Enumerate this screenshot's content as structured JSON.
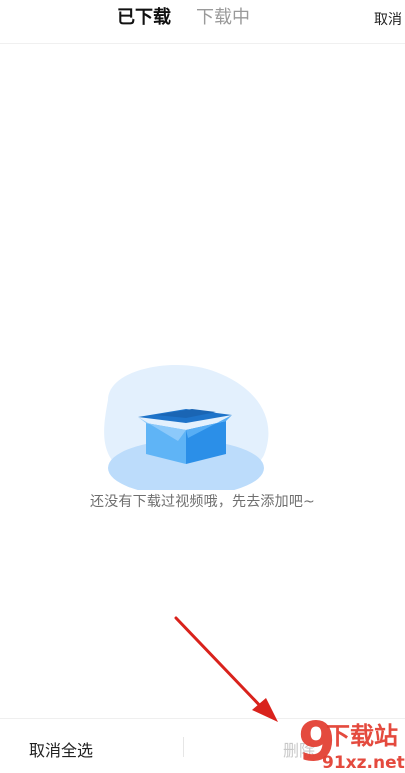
{
  "header": {
    "tabs": [
      {
        "label": "已下载",
        "active": true
      },
      {
        "label": "下载中",
        "active": false
      }
    ],
    "cancel_label": "取消"
  },
  "empty_state": {
    "icon": "open-box-icon",
    "message": "还没有下载过视频哦，先去添加吧~"
  },
  "bottom_bar": {
    "cancel_select_all_label": "取消全选",
    "delete_label": "删除"
  },
  "annotation": {
    "icon": "red-arrow-icon",
    "color": "#d9221c"
  },
  "watermark": {
    "logo_text": "下载站",
    "site_text": "91xz.net"
  },
  "colors": {
    "accent_blue": "#3aa0f2",
    "text_primary": "#111111",
    "text_muted": "#9a9a9a"
  }
}
